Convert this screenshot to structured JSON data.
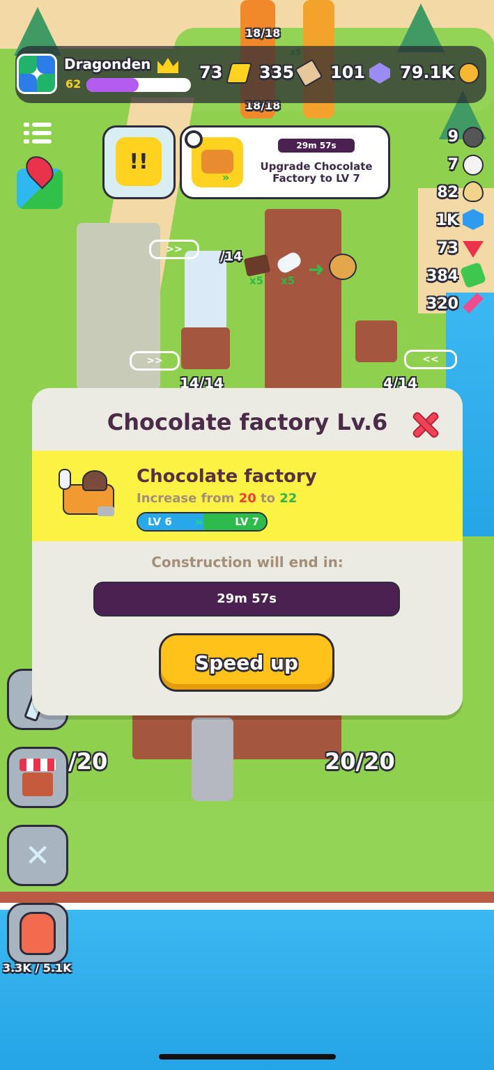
{
  "player": {
    "name": "Dragonden",
    "level": "62",
    "xp_fraction": 0.5
  },
  "top_resources": [
    {
      "value": "73",
      "icon": "ticket-icon",
      "color": "#ffd21f"
    },
    {
      "value": "335",
      "icon": "scroll-icon",
      "color": "#e8c89a"
    },
    {
      "value": "101",
      "icon": "gem-icon",
      "color": "#9a8cf2"
    },
    {
      "value": "79.1K",
      "icon": "coin-icon",
      "color": "#f7b731"
    }
  ],
  "side_resources": [
    {
      "value": "9",
      "icon": "bomb-icon",
      "color": "#555555"
    },
    {
      "value": "7",
      "icon": "cloud-icon",
      "color": "#f3f3f3"
    },
    {
      "value": "82",
      "icon": "egg-icon",
      "color": "#f1d38a"
    },
    {
      "value": "1K",
      "icon": "blue-crystal-icon",
      "color": "#2f9bf0"
    },
    {
      "value": "73",
      "icon": "red-gem-icon",
      "color": "#e8334a"
    },
    {
      "value": "384",
      "icon": "green-gem-icon",
      "color": "#3ec74e"
    },
    {
      "value": "320",
      "icon": "pink-crystal-icon",
      "color": "#ee4c8e"
    }
  ],
  "world_labels": {
    "stock_top": "18/18",
    "stock_top2": "18/18",
    "multiplier_top": "x5",
    "stock_mid": "/14",
    "multiplier_a": "x5",
    "multiplier_b": "x5",
    "stock_left": "14/14",
    "stock_right": "4/14",
    "stock_bottom_left": "/20",
    "stock_bottom_right": "20/20",
    "backpack_capacity": "3.3K / 5.1K"
  },
  "task_card": {
    "timer": "29m 57s",
    "text": "Upgrade Chocolate Factory to LV 7"
  },
  "alert_card": {
    "symbol": "!!"
  },
  "modal": {
    "title": "Chocolate factory Lv.6",
    "building_name": "Chocolate factory",
    "desc_prefix": "Increase from ",
    "from_value": "20",
    "desc_mid": " to ",
    "to_value": "22",
    "level_from": "LV 6",
    "level_to": "LV 7",
    "construction_label": "Construction will end in:",
    "timer": "29m 57s",
    "progress_fraction": 1.0,
    "speed_up_label": "Speed up"
  },
  "colors": {
    "modal_bg": "#ecebe3",
    "band": "#fbf243",
    "progress": "#4a2150",
    "button": "#ffc21a",
    "close": "#f0435a"
  }
}
